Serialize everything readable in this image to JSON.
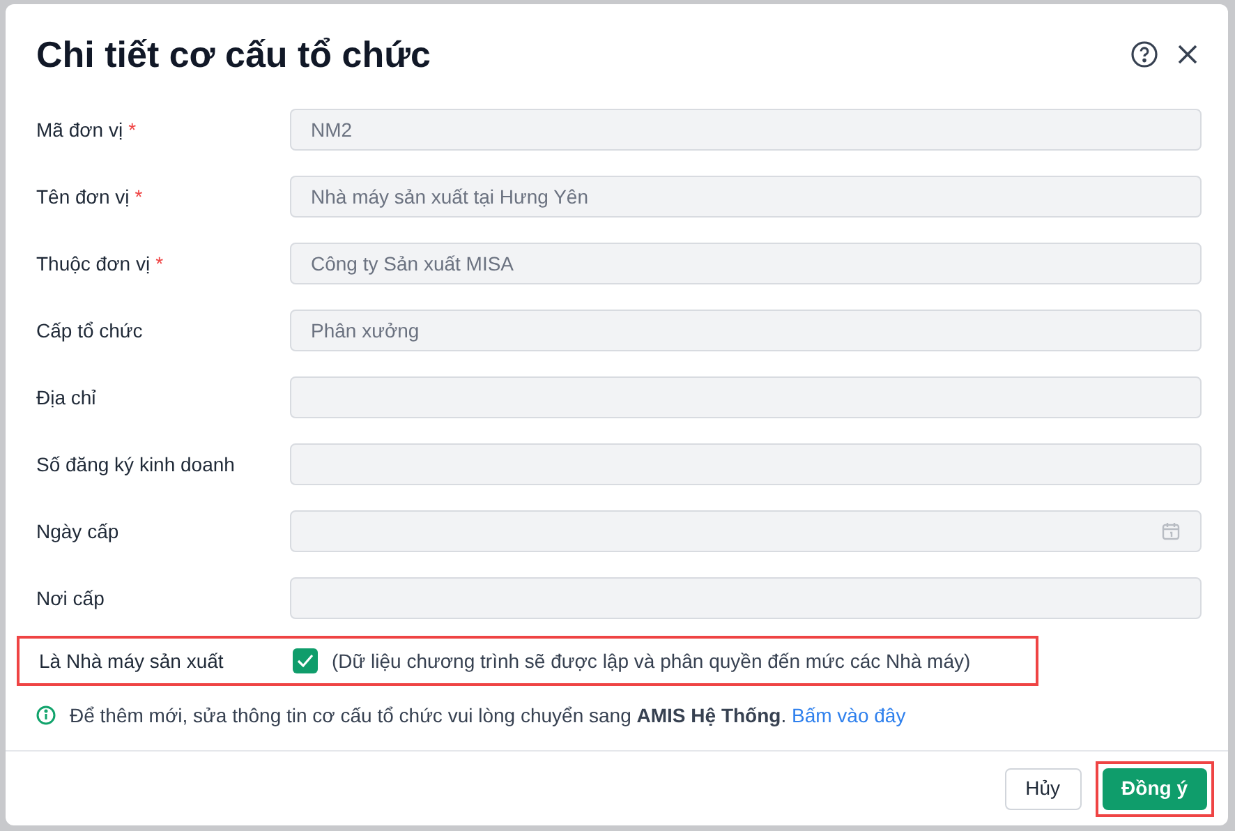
{
  "dialog": {
    "title": "Chi tiết cơ cấu tổ chức"
  },
  "fields": [
    {
      "label": "Mã đơn vị",
      "required_mark": "*",
      "value": "NM2",
      "kind": "text"
    },
    {
      "label": "Tên đơn vị",
      "required_mark": "*",
      "value": "Nhà máy sản xuất tại Hưng Yên",
      "kind": "text"
    },
    {
      "label": "Thuộc đơn vị",
      "required_mark": "*",
      "value": "Công ty Sản xuất MISA",
      "kind": "text"
    },
    {
      "label": "Cấp tổ chức",
      "value": "Phân xưởng",
      "kind": "text"
    },
    {
      "label": "Địa chỉ",
      "kind": "text"
    },
    {
      "label": "Số đăng ký kinh doanh",
      "kind": "text"
    },
    {
      "label": "Ngày cấp",
      "kind": "date"
    },
    {
      "label": "Nơi cấp",
      "kind": "text"
    }
  ],
  "factory_option": {
    "label": "Là Nhà máy sản xuất",
    "checked": true,
    "note": "(Dữ liệu chương trình sẽ được lập và phân quyền đến mức các Nhà máy)",
    "highlighted": true
  },
  "info": {
    "text": "Để thêm mới, sửa thông tin cơ cấu tổ chức vui lòng chuyển sang **AMIS Hệ Thống**.",
    "link": "Bấm vào đây"
  },
  "buttons": [
    {
      "label": "Hủy",
      "kind": "secondary",
      "highlighted": false
    },
    {
      "label": "Đồng ý",
      "kind": "primary",
      "highlighted": true
    }
  ]
}
